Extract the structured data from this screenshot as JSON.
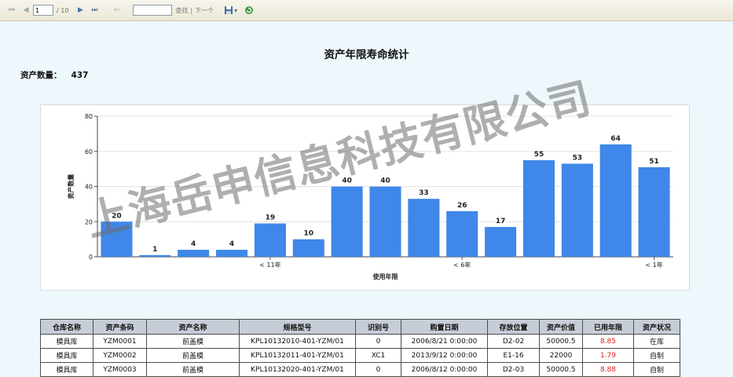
{
  "toolbar": {
    "first_icon": "first-page-icon",
    "prev_icon": "prev-page-icon",
    "page_value": "1",
    "page_total": "/ 10",
    "next_icon": "next-page-icon",
    "last_icon": "last-page-icon",
    "back_icon": "back-icon",
    "find_label": "查找",
    "find_sep": "|",
    "next_label": "下一个",
    "export_icon": "save-export-icon",
    "refresh_icon": "refresh-icon"
  },
  "report": {
    "title": "资产年限寿命统计",
    "count_label": "资产数量：",
    "count_value": "437"
  },
  "chart_data": {
    "type": "bar",
    "values": [
      20,
      1,
      4,
      4,
      19,
      10,
      40,
      40,
      33,
      26,
      17,
      55,
      53,
      64,
      51
    ],
    "category_labels": [
      {
        "index": 4,
        "label": "< 11年"
      },
      {
        "index": 9,
        "label": "< 6年"
      },
      {
        "index": 14,
        "label": "< 1年"
      }
    ],
    "ylim": [
      0,
      80
    ],
    "yticks": [
      0,
      20,
      40,
      60,
      80
    ],
    "ylabel": "资产数量",
    "xlabel": "使用年限",
    "bar_color": "#3f87e8",
    "grid": true
  },
  "watermark": "上海岳申信息科技有限公司",
  "table": {
    "headers": [
      "仓库名称",
      "资产条码",
      "资产名称",
      "规格型号",
      "识别号",
      "购置日期",
      "存放位置",
      "资产价值",
      "已用年限",
      "资产状况"
    ],
    "rows": [
      [
        "模具库",
        "YZM0001",
        "前盖模",
        "KPL10132010-401-YZM/01",
        "0",
        "2006/8/21 0:00:00",
        "D2-02",
        "50000.5",
        "8.85",
        "在库"
      ],
      [
        "模具库",
        "YZM0002",
        "前盖模",
        "KPL10132011-401-YZM/01",
        "XC1",
        "2013/9/12 0:00:00",
        "E1-16",
        "22000",
        "1.79",
        "自制"
      ],
      [
        "模具库",
        "YZM0003",
        "前盖模",
        "KPL10132020-401-YZM/01",
        "0",
        "2006/8/12 0:00:00",
        "D2-03",
        "50000.5",
        "8.88",
        "自制"
      ]
    ],
    "highlight_color": "#e41e1e"
  }
}
